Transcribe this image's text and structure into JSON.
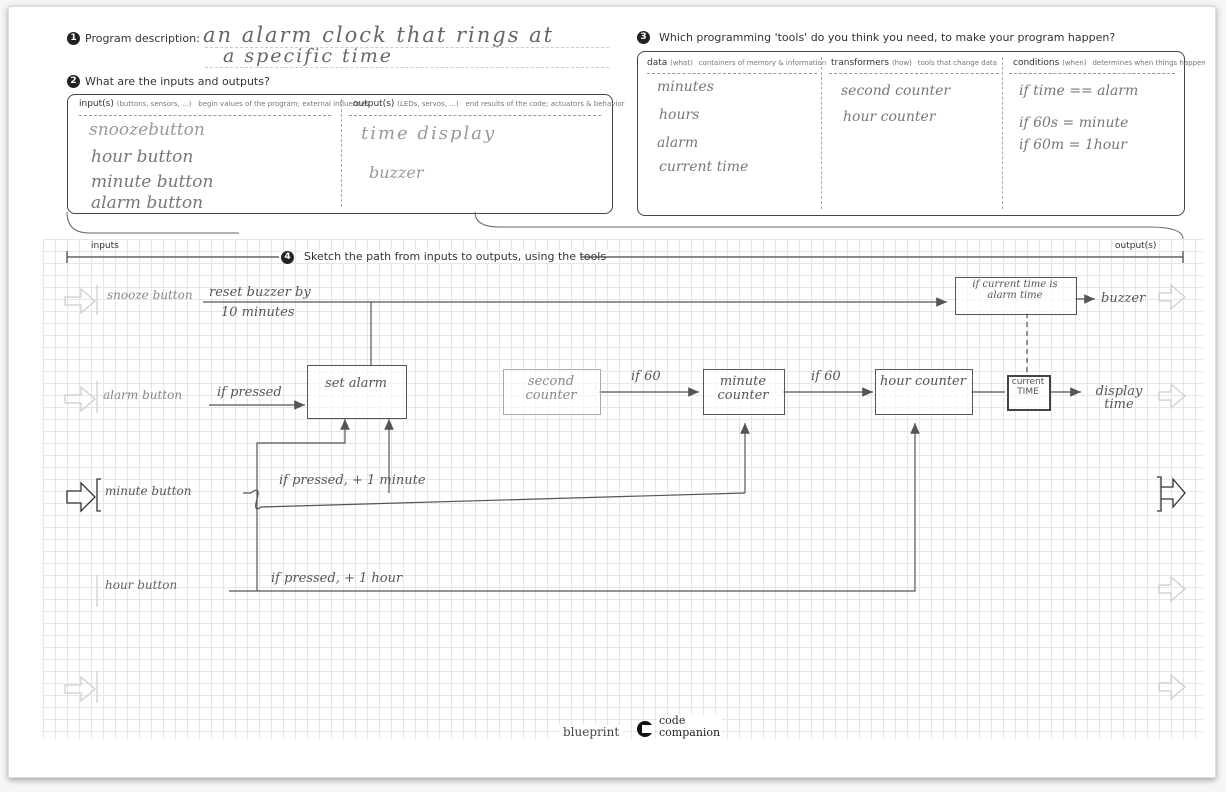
{
  "section1": {
    "number": "1",
    "label": "Program description:",
    "answer_line1": "an alarm clock that rings at",
    "answer_line2": "a specific time"
  },
  "section2": {
    "number": "2",
    "label": "What are the inputs and outputs?",
    "inputs_header": "input(s)",
    "inputs_sub": "(buttons, sensors, ...)",
    "inputs_desc": "begin values of the program; external influences",
    "outputs_header": "output(s)",
    "outputs_sub": "(LEDs, servos, ...)",
    "outputs_desc": "end results of the code; actuators & behavior",
    "inputs": [
      "snoozebutton",
      "hour button",
      "minute button",
      "alarm button"
    ],
    "outputs": [
      "time display",
      "buzzer"
    ]
  },
  "section3": {
    "number": "3",
    "label": "Which programming 'tools' do you think you need, to make your program happen?",
    "data_header": "data",
    "data_sub": "(what)",
    "data_desc": "containers of memory & information",
    "transformers_header": "transformers",
    "transformers_sub": "(how)",
    "transformers_desc": "tools that change data",
    "conditions_header": "conditions",
    "conditions_sub": "(when)",
    "conditions_desc": "determines when things happen",
    "data_items": [
      "minutes",
      "hours",
      "alarm",
      "current time"
    ],
    "transformer_items": [
      "second counter",
      "hour counter"
    ],
    "condition_items": [
      "if time == alarm",
      "if 60s = minute",
      "if 60m = 1hour"
    ]
  },
  "section4": {
    "number": "4",
    "label": "Sketch the path from inputs to outputs, using the tools",
    "inputs_label": "inputs",
    "outputs_label": "output(s)"
  },
  "diagram": {
    "inputs": {
      "snooze": "snooze button",
      "alarm": "alarm button",
      "minute": "minute button",
      "hour": "hour button"
    },
    "nodes": {
      "set_alarm": "set alarm",
      "second_counter": "second counter",
      "minute_counter": "minute counter",
      "hour_counter": "hour counter",
      "condition": "if current time is alarm time",
      "current_time": "current TIME"
    },
    "edges": {
      "snooze_line1": "reset buzzer by",
      "snooze_line2": "10 minutes",
      "alarm_pressed": "if pressed",
      "minute_pressed": "if pressed,   + 1   minute",
      "hour_pressed": "if pressed,   + 1  hour",
      "if60_a": "if 60",
      "if60_b": "if 60"
    },
    "outputs": {
      "buzzer": "buzzer",
      "display": "display time"
    }
  },
  "footer": {
    "blueprint": "blueprint",
    "companion_line1": "code",
    "companion_line2": "companion"
  }
}
